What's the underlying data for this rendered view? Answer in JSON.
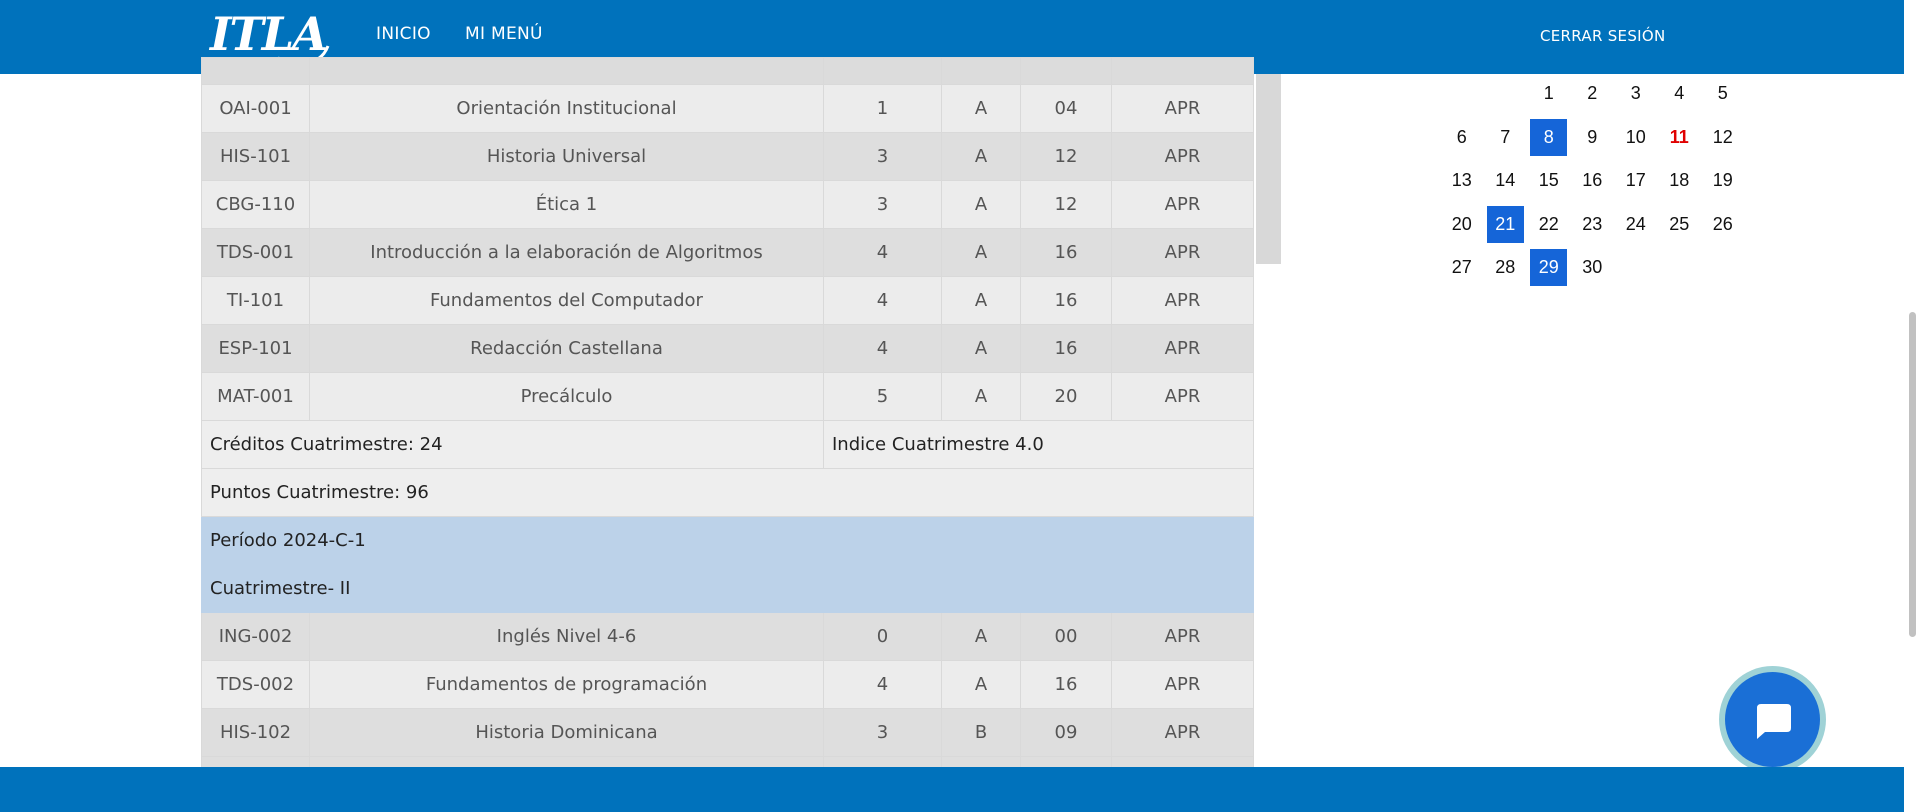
{
  "header": {
    "logo_text": "ITLA",
    "nav": [
      "INICIO",
      "MI MENÚ"
    ],
    "logout": "CERRAR SESIÓN"
  },
  "table": {
    "courses_group1": [
      {
        "code": "OAI-001",
        "name": "Orientación Institucional",
        "credits": "1",
        "grade": "A",
        "points": "04",
        "status": "APR"
      },
      {
        "code": "HIS-101",
        "name": "Historia Universal",
        "credits": "3",
        "grade": "A",
        "points": "12",
        "status": "APR"
      },
      {
        "code": "CBG-110",
        "name": "Ética 1",
        "credits": "3",
        "grade": "A",
        "points": "12",
        "status": "APR"
      },
      {
        "code": "TDS-001",
        "name": "Introducción a la elaboración de Algoritmos",
        "credits": "4",
        "grade": "A",
        "points": "16",
        "status": "APR"
      },
      {
        "code": "TI-101",
        "name": "Fundamentos del Computador",
        "credits": "4",
        "grade": "A",
        "points": "16",
        "status": "APR"
      },
      {
        "code": "ESP-101",
        "name": "Redacción Castellana",
        "credits": "4",
        "grade": "A",
        "points": "16",
        "status": "APR"
      },
      {
        "code": "MAT-001",
        "name": "Precálculo",
        "credits": "5",
        "grade": "A",
        "points": "20",
        "status": "APR"
      }
    ],
    "summary": {
      "credits": "Créditos Cuatrimestre: 24",
      "index": "Indice Cuatrimestre 4.0",
      "points": "Puntos Cuatrimestre: 96"
    },
    "period": "Período 2024-C-1",
    "term": "Cuatrimestre- II",
    "courses_group2": [
      {
        "code": "ING-002",
        "name": "Inglés Nivel 4-6",
        "credits": "0",
        "grade": "A",
        "points": "00",
        "status": "APR"
      },
      {
        "code": "TDS-002",
        "name": "Fundamentos de programación",
        "credits": "4",
        "grade": "A",
        "points": "16",
        "status": "APR"
      },
      {
        "code": "HIS-102",
        "name": "Historia Dominicana",
        "credits": "3",
        "grade": "B",
        "points": "09",
        "status": "APR"
      }
    ]
  },
  "calendar": {
    "weeks": [
      [
        "",
        "",
        "1",
        "2",
        "3",
        "4",
        "5"
      ],
      [
        "6",
        "7",
        "8",
        "9",
        "10",
        "11",
        "12"
      ],
      [
        "13",
        "14",
        "15",
        "16",
        "17",
        "18",
        "19"
      ],
      [
        "20",
        "21",
        "22",
        "23",
        "24",
        "25",
        "26"
      ],
      [
        "27",
        "28",
        "29",
        "30",
        "",
        "",
        ""
      ]
    ],
    "selected_days": [
      "8",
      "21",
      "29"
    ],
    "holiday_days": [
      "11"
    ],
    "selected_color": "#1565d8",
    "holiday_color": "#e00000"
  },
  "colors": {
    "brand_blue": "#0072bc",
    "period_row": "#bcd2e9"
  },
  "icons": {
    "chat": "chat-bubble-icon"
  }
}
